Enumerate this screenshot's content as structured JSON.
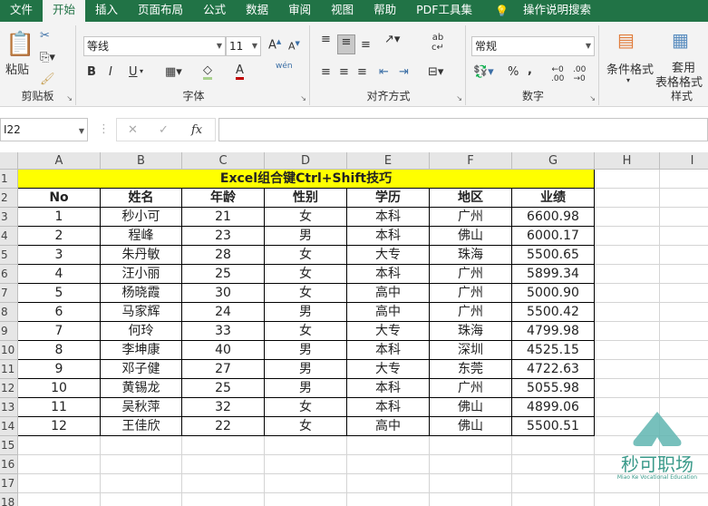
{
  "tabs": [
    "文件",
    "开始",
    "插入",
    "页面布局",
    "公式",
    "数据",
    "审阅",
    "视图",
    "帮助",
    "PDF工具集",
    "操作说明搜索"
  ],
  "ribbon": {
    "clipboard": {
      "label": "剪贴板",
      "paste": "粘贴"
    },
    "font": {
      "label": "字体",
      "name": "等线",
      "size": "11",
      "bold": "B",
      "italic": "I",
      "underline": "U",
      "phonetic": "wén"
    },
    "align": {
      "label": "对齐方式"
    },
    "number": {
      "label": "数字",
      "format": "常规",
      "percent": "%",
      "comma": ","
    },
    "styles": {
      "label": "样式",
      "cond": "条件格式",
      "table1": "套用",
      "table2": "表格格式"
    }
  },
  "formula": {
    "namebox": "I22",
    "fx": "fx",
    "value": ""
  },
  "columns": [
    "A",
    "B",
    "C",
    "D",
    "E",
    "F",
    "G",
    "H",
    "I"
  ],
  "rows": [
    "1",
    "2",
    "3",
    "4",
    "5",
    "6",
    "7",
    "8",
    "9",
    "10",
    "11",
    "12",
    "13",
    "14",
    "15",
    "16",
    "17",
    "18"
  ],
  "sheet": {
    "title": "Excel组合键Ctrl+Shift技巧",
    "headers": [
      "No",
      "姓名",
      "年龄",
      "性别",
      "学历",
      "地区",
      "业绩"
    ],
    "data": [
      [
        "1",
        "秒小可",
        "21",
        "女",
        "本科",
        "广州",
        "6600.98"
      ],
      [
        "2",
        "程峰",
        "23",
        "男",
        "本科",
        "佛山",
        "6000.17"
      ],
      [
        "3",
        "朱丹敏",
        "28",
        "女",
        "大专",
        "珠海",
        "5500.65"
      ],
      [
        "4",
        "汪小丽",
        "25",
        "女",
        "本科",
        "广州",
        "5899.34"
      ],
      [
        "5",
        "杨晓霞",
        "30",
        "女",
        "高中",
        "广州",
        "5000.90"
      ],
      [
        "6",
        "马家辉",
        "24",
        "男",
        "高中",
        "广州",
        "5500.42"
      ],
      [
        "7",
        "何玲",
        "33",
        "女",
        "大专",
        "珠海",
        "4799.98"
      ],
      [
        "8",
        "李坤康",
        "40",
        "男",
        "本科",
        "深圳",
        "4525.15"
      ],
      [
        "9",
        "邓子健",
        "27",
        "男",
        "大专",
        "东莞",
        "4722.63"
      ],
      [
        "10",
        "黄锡龙",
        "25",
        "男",
        "本科",
        "广州",
        "5055.98"
      ],
      [
        "11",
        "吴秋萍",
        "32",
        "女",
        "本科",
        "佛山",
        "4899.06"
      ],
      [
        "12",
        "王佳欣",
        "22",
        "女",
        "高中",
        "佛山",
        "5500.51"
      ]
    ]
  },
  "watermark": {
    "name": "秒可职场",
    "sub": "Miao Ke Vocational Education"
  },
  "colors": {
    "green": "#217346",
    "title_fill": "#ffff00"
  }
}
